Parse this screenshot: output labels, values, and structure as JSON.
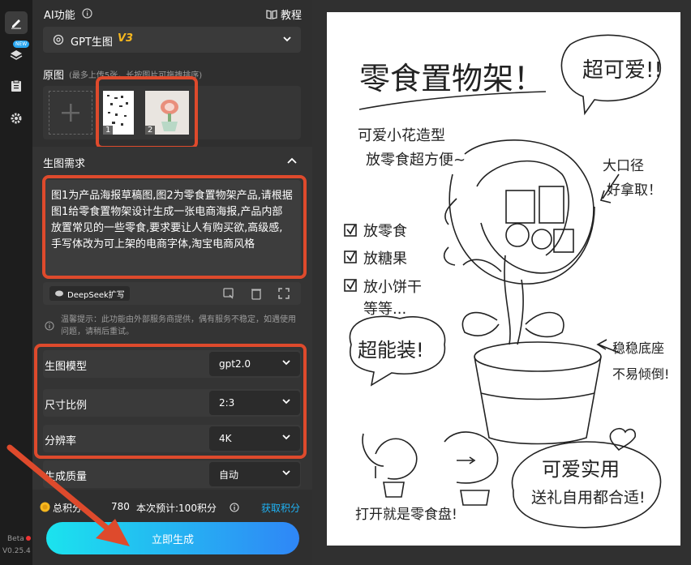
{
  "rail": {
    "new_badge": "NEW",
    "beta": "Beta",
    "version": "V0.25.4"
  },
  "header": {
    "title": "AI功能",
    "tutorial": "教程"
  },
  "model_picker": {
    "label": "GPT生图",
    "version": "V3"
  },
  "source": {
    "title": "原图",
    "hint": "(最多上传5张，长按图片可拖拽排序)",
    "thumbs": [
      {
        "index": "1"
      },
      {
        "index": "2"
      }
    ]
  },
  "prompt": {
    "title": "生图需求",
    "text": "图1为产品海报草稿图,图2为零食置物架产品,请根据图1给零食置物架设计生成一张电商海报,产品内部放置常见的一些零食,要求要让人有购买欲,高级感,手写体改为可上架的电商字体,淘宝电商风格",
    "expand": "DeepSeek扩写"
  },
  "notice": "温馨提示：此功能由外部服务商提供，偶有服务不稳定，如遇使用问题，请稍后重试。",
  "settings": [
    {
      "label": "生图模型",
      "value": "gpt2.0"
    },
    {
      "label": "尺寸比例",
      "value": "2:3"
    },
    {
      "label": "分辨率",
      "value": "4K"
    },
    {
      "label": "生成质量",
      "value": "自动"
    }
  ],
  "points": {
    "total_label": "总积分:",
    "total_value": "780",
    "estimate": "本次预计:100积分",
    "get_points": "获取积分"
  },
  "generate": "立即生成",
  "colors": {
    "accent": "#1fb3f5",
    "red_box": "#de4a2c",
    "gold": "#f5b71f"
  },
  "poster": {
    "title": "零食置物架！",
    "bubble_top": "超可爱!!",
    "sub1": "可爱小花造型",
    "sub2": "放零食超方便~",
    "mouth1": "大口径",
    "mouth2": "好拿取！",
    "checks": [
      "放零食",
      "放糖果",
      "放小饼干"
    ],
    "etc": "等等...",
    "big": "超能装!",
    "base1": "稳稳底座",
    "base2": "不易倾倒!",
    "bubble_bottom1": "可爱实用",
    "bubble_bottom2": "送礼自用都合适!",
    "open": "打开就是零食盘!"
  }
}
